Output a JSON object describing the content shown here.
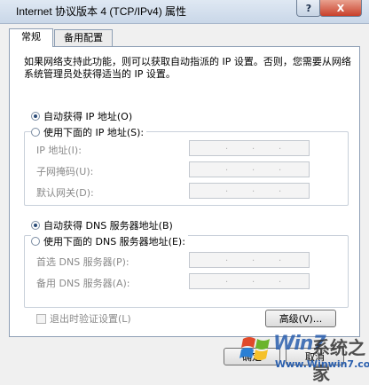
{
  "window": {
    "title": "Internet 协议版本 4 (TCP/IPv4) 属性",
    "help": "?",
    "close": "X"
  },
  "tabs": [
    {
      "label": "常规"
    },
    {
      "label": "备用配置"
    }
  ],
  "description": "如果网络支持此功能，则可以获取自动指派的 IP 设置。否则，您需要从网络系统管理员处获得适当的 IP 设置。",
  "ip": {
    "auto_label": "自动获得 IP 地址(O)",
    "manual_label": "使用下面的 IP 地址(S):",
    "auto_selected": true,
    "fields": [
      {
        "label": "IP 地址(I):"
      },
      {
        "label": "子网掩码(U):"
      },
      {
        "label": "默认网关(D):"
      }
    ]
  },
  "dns": {
    "auto_label": "自动获得 DNS 服务器地址(B)",
    "manual_label": "使用下面的 DNS 服务器地址(E):",
    "auto_selected": true,
    "fields": [
      {
        "label": "首选 DNS 服务器(P):"
      },
      {
        "label": "备用 DNS 服务器(A):"
      }
    ]
  },
  "validate_on_exit": {
    "label": "退出时验证设置(L)",
    "checked": false
  },
  "buttons": {
    "advanced": "高级(V)...",
    "ok": "确定",
    "cancel": "取消"
  },
  "watermark": {
    "brand": "Win7",
    "suffix": "系统之家",
    "url": "Www.Winwin7.com"
  }
}
